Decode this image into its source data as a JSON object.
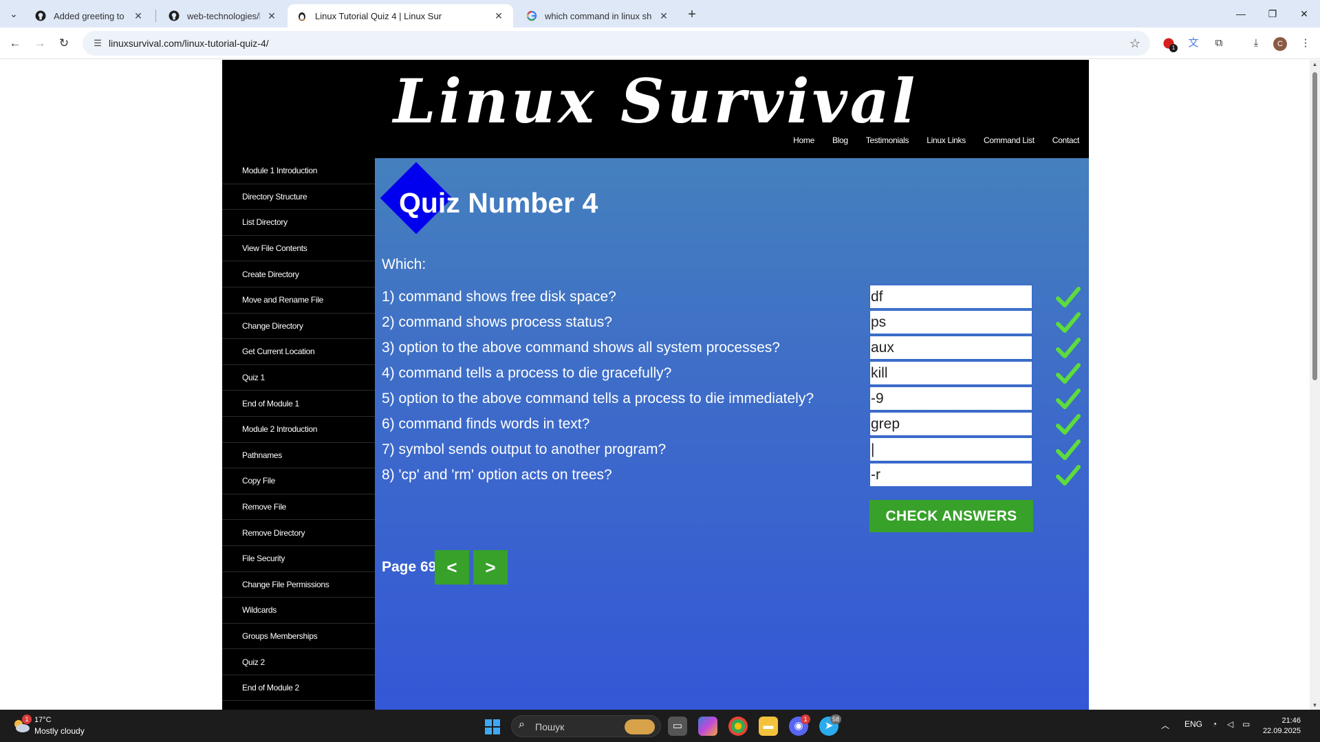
{
  "browser": {
    "tabs": [
      {
        "title": "Added greeting to ReadME by",
        "icon": "github-icon",
        "active": false
      },
      {
        "title": "web-technologies/html-css/lab",
        "icon": "github-icon",
        "active": false
      },
      {
        "title": "Linux Tutorial Quiz 4 | Linux Sur",
        "icon": "linux-survival-favicon",
        "active": true
      },
      {
        "title": "which command in linux shows",
        "icon": "google-icon",
        "active": false
      }
    ],
    "url": "linuxsurvival.com/linux-tutorial-quiz-4/",
    "extension_badge": "1",
    "profile_initial": "C"
  },
  "site": {
    "logo": "Linux Survival",
    "nav": [
      "Home",
      "Blog",
      "Testimonials",
      "Linux Links",
      "Command List",
      "Contact"
    ],
    "sidebar": [
      "Module 1 Introduction",
      "Directory Structure",
      "List Directory",
      "View File Contents",
      "Create Directory",
      "Move and Rename File",
      "Change Directory",
      "Get Current Location",
      "Quiz 1",
      "End of Module 1",
      "Module 2 Introduction",
      "Pathnames",
      "Copy File",
      "Remove File",
      "Remove Directory",
      "File Security",
      "Change File Permissions",
      "Wildcards",
      "Groups Memberships",
      "Quiz 2",
      "End of Module 2"
    ]
  },
  "quiz": {
    "title": "Quiz Number 4",
    "intro": "Which:",
    "questions": [
      {
        "text": "1) command shows free disk space?",
        "answer": "df",
        "correct": true
      },
      {
        "text": "2) command shows process status?",
        "answer": "ps",
        "correct": true
      },
      {
        "text": "3) option to the above command shows all system processes?",
        "answer": "aux",
        "correct": true
      },
      {
        "text": "4) command tells a process to die gracefully?",
        "answer": "kill",
        "correct": true
      },
      {
        "text": "5) option to the above command tells a process to die immediately?",
        "answer": "-9",
        "correct": true
      },
      {
        "text": "6) command finds words in text?",
        "answer": "grep",
        "correct": true
      },
      {
        "text": "7) symbol sends output to another program?",
        "answer": "|",
        "correct": true
      },
      {
        "text": "8) 'cp' and 'rm' option acts on trees?",
        "answer": "-r",
        "correct": true
      }
    ],
    "check_button": "CHECK ANSWERS",
    "page_label": "Page 69",
    "prev_label": "<",
    "next_label": ">",
    "check_color": "#5ddc3c",
    "button_color": "#37a12a",
    "diamond_color": "#0000ee"
  },
  "taskbar": {
    "temperature": "17°C",
    "weather": "Mostly cloudy",
    "weather_badge": "1",
    "search_placeholder": "Пошук",
    "discord_badge": "1",
    "telegram_badge": "58",
    "language": "ENG",
    "time": "21:46",
    "date": "22.09.2025"
  }
}
